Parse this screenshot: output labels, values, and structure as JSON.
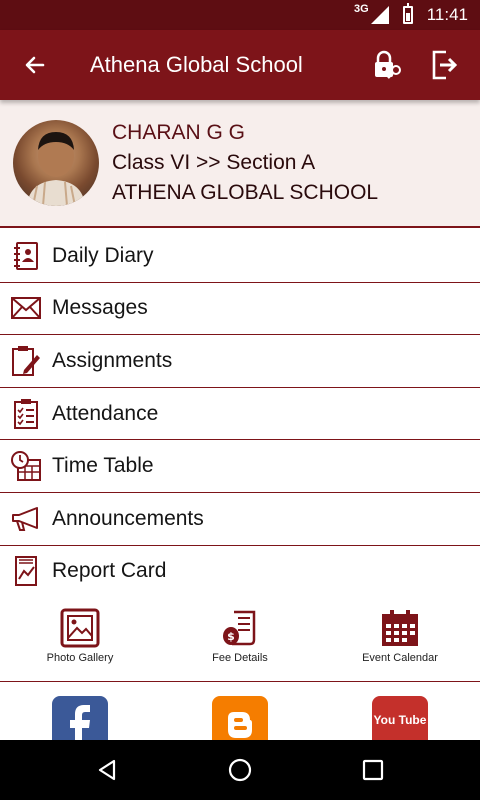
{
  "status_bar": {
    "network": "3G",
    "time": "11:41"
  },
  "app_bar": {
    "title": "Athena Global School"
  },
  "profile": {
    "name": "CHARAN G G",
    "class_section": "Class VI >> Section A",
    "school": "ATHENA GLOBAL SCHOOL"
  },
  "menu": {
    "items": [
      {
        "label": "Daily Diary",
        "icon": "diary-icon"
      },
      {
        "label": "Messages",
        "icon": "envelope-icon"
      },
      {
        "label": "Assignments",
        "icon": "clipboard-pencil-icon"
      },
      {
        "label": "Attendance",
        "icon": "checklist-icon"
      },
      {
        "label": "Time Table",
        "icon": "clock-calendar-icon"
      },
      {
        "label": "Announcements",
        "icon": "megaphone-icon"
      },
      {
        "label": "Report Card",
        "icon": "chart-document-icon"
      }
    ]
  },
  "quick_links": [
    {
      "label": "Photo Gallery",
      "icon": "image-frame-icon"
    },
    {
      "label": "Fee Details",
      "icon": "money-scroll-icon"
    },
    {
      "label": "Event Calendar",
      "icon": "calendar-icon"
    }
  ],
  "social": [
    {
      "icon": "facebook-icon",
      "color": "#3b5998"
    },
    {
      "icon": "blogger-icon",
      "color": "#f57d00"
    },
    {
      "icon": "youtube-icon",
      "color": "#c4302b",
      "text": "You Tube"
    }
  ],
  "colors": {
    "primary": "#7d1419",
    "status": "#5e0d12",
    "profile_bg": "#f7eeec"
  }
}
